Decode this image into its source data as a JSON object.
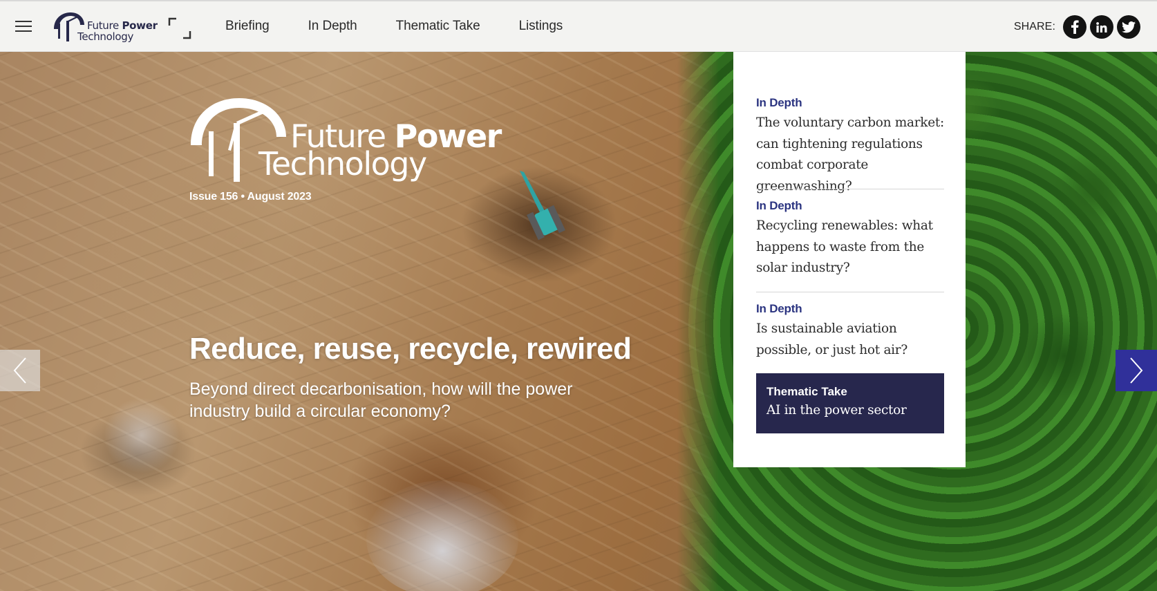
{
  "header": {
    "logo": {
      "word1": "Future",
      "word1_bold": "Power",
      "word2": "Technology"
    },
    "nav": [
      "Briefing",
      "In Depth",
      "Thematic Take",
      "Listings"
    ],
    "share_label": "SHARE:",
    "share_icons": [
      "facebook-icon",
      "linkedin-icon",
      "twitter-icon"
    ]
  },
  "hero": {
    "logo": {
      "word1": "Future",
      "word1_bold": "Power",
      "word2": "Technology"
    },
    "issue": "Issue 156 • August 2023",
    "headline": "Reduce, reuse, recycle, rewired",
    "subhead": "Beyond direct decarbonisation, how will the power industry build a circular economy?"
  },
  "panel": {
    "articles": [
      {
        "category": "In Depth",
        "title": "The voluntary carbon market: can tightening regulations combat corporate greenwashing?"
      },
      {
        "category": "In Depth",
        "title": "Recycling renewables: what happens to waste from the solar industry?"
      },
      {
        "category": "In Depth",
        "title": "Is sustainable aviation possible, or just hot air?"
      }
    ],
    "thematic": {
      "category": "Thematic Take",
      "title": "AI in the power sector"
    }
  },
  "colors": {
    "accent": "#2b3480",
    "thematic_bg": "#27274d",
    "arrow_right": "#30309a",
    "topbar": "#f3f3f1"
  }
}
